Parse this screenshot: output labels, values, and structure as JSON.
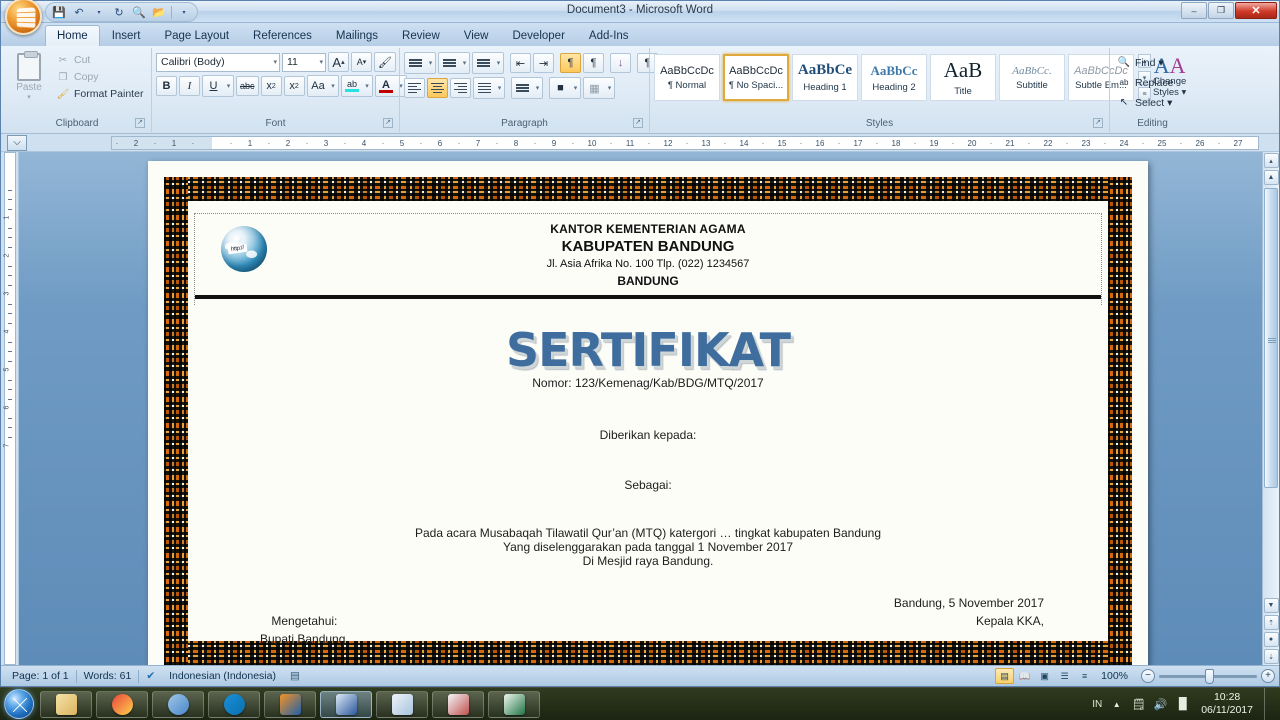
{
  "window": {
    "title": "Document3 - Microsoft Word",
    "min_label": "–",
    "restore_label": "❐",
    "close_label": "✕"
  },
  "quick_access": [
    {
      "name": "save-icon",
      "glyph": "💾"
    },
    {
      "name": "undo-icon",
      "glyph": "↶"
    },
    {
      "name": "undo-dropdown-icon",
      "glyph": "▾"
    },
    {
      "name": "redo-icon",
      "glyph": "↻"
    },
    {
      "name": "print-preview-icon",
      "glyph": "🔍"
    },
    {
      "name": "open-icon",
      "glyph": "📂"
    },
    {
      "name": "customize-qat-icon",
      "glyph": "▾"
    }
  ],
  "tabs": [
    {
      "label": "Home",
      "active": true
    },
    {
      "label": "Insert",
      "active": false
    },
    {
      "label": "Page Layout",
      "active": false
    },
    {
      "label": "References",
      "active": false
    },
    {
      "label": "Mailings",
      "active": false
    },
    {
      "label": "Review",
      "active": false
    },
    {
      "label": "View",
      "active": false
    },
    {
      "label": "Developer",
      "active": false
    },
    {
      "label": "Add-Ins",
      "active": false
    }
  ],
  "ribbon": {
    "clipboard": {
      "label": "Clipboard",
      "paste_label": "Paste",
      "paste_arrow": "▾",
      "commands": [
        {
          "label": "Cut",
          "icon": "scissors-icon",
          "glyph": "✂"
        },
        {
          "label": "Copy",
          "icon": "copy-icon",
          "glyph": "❐"
        },
        {
          "label": "Format Painter",
          "icon": "format-painter-icon",
          "glyph": "🖌"
        }
      ]
    },
    "font": {
      "label": "Font",
      "font_name": "Calibri (Body)",
      "font_size": "11",
      "grow_label": "A",
      "shrink_label": "A",
      "clear_formatting_label": "🖌",
      "bold_label": "B",
      "italic_label": "I",
      "underline_label": "U",
      "strike_label": "abc",
      "subscript_label": "x",
      "subscript_sub": "2",
      "superscript_label": "x",
      "superscript_sup": "2",
      "change_case_label": "Aa",
      "highlight_label": "ab",
      "font_color_label": "A"
    },
    "paragraph": {
      "label": "Paragraph",
      "bullets": "≡",
      "numbering": "≡",
      "multilevel": "≡",
      "decrease_indent": "⇤",
      "increase_indent": "⇥",
      "ltr": "¶",
      "rtl": "¶",
      "sort": "↓",
      "show_marks": "¶",
      "align_left": "≡",
      "align_center": "≡",
      "align_right": "≡",
      "justify": "≡",
      "line_spacing": "≡",
      "shading": "■",
      "borders": "▦"
    },
    "styles": {
      "label": "Styles",
      "gallery": [
        {
          "preview": "AaBbCcDc",
          "name": "¶ Normal",
          "selected": false
        },
        {
          "preview": "AaBbCcDc",
          "name": "¶ No Spaci...",
          "selected": true
        },
        {
          "preview": "AaBbCе",
          "name": "Heading 1",
          "selected": false
        },
        {
          "preview": "AaBbCc",
          "name": "Heading 2",
          "selected": false
        },
        {
          "preview": "AaB",
          "name": "Title",
          "selected": false
        },
        {
          "preview": "AaBbCc.",
          "name": "Subtitle",
          "selected": false
        },
        {
          "preview": "AaBbCcDc",
          "name": "Subtle Em...",
          "selected": false
        }
      ],
      "scroll_up": "▴",
      "scroll_down": "▾",
      "more": "≡",
      "change_styles_line1": "Change",
      "change_styles_line2": "Styles ▾"
    },
    "editing": {
      "label": "Editing",
      "commands": [
        {
          "label": "Find ▾",
          "icon": "binoculars-icon",
          "glyph": "🔍"
        },
        {
          "label": "Replace",
          "icon": "replace-icon",
          "glyph": "ab"
        },
        {
          "label": "Select ▾",
          "icon": "select-icon",
          "glyph": "↖"
        }
      ]
    }
  },
  "ruler": {
    "tab_stop_glyph": "⌵",
    "left_ticks": [
      "2",
      "1"
    ],
    "right_ticks": [
      "1",
      "2",
      "3",
      "4",
      "5",
      "6",
      "7",
      "8",
      "9",
      "10",
      "11",
      "12",
      "13",
      "14",
      "15",
      "16",
      "17",
      "18",
      "19",
      "20",
      "21",
      "22",
      "23",
      "24",
      "25",
      "26",
      "27"
    ],
    "vertical_ticks": [
      "1",
      "2",
      "3",
      "4",
      "5",
      "6",
      "7"
    ]
  },
  "document": {
    "letterhead": {
      "line1": "KANTOR KEMENTERIAN AGAMA",
      "line2": "KABUPATEN BANDUNG",
      "line3": "Jl. Asia Afrika No. 100 Tlp. (022) 1234567",
      "line4": "BANDUNG",
      "logo_name": "globe-internet-logo"
    },
    "title": "SERTIFIKAT",
    "title_color": "#3f6e9e",
    "nomor": "Nomor: 123/Kemenag/Kab/BDG/MTQ/2017",
    "given_to": "Diberikan kepada:",
    "as": "Sebagai:",
    "body": [
      "Pada acara Musabaqah Tilawatil Qur’an (MTQ) katergori … tingkat kabupaten Bandung",
      "Yang diselenggarakan pada tanggal 1 November 2017",
      "Di Mesjid raya Bandung."
    ],
    "sign_right_line1": "Bandung, 5 November 2017",
    "sign_right_line2": "Kepala KKA,",
    "sign_left_line1": "Mengetahui:",
    "sign_left_line2": "Bupati Bandung,"
  },
  "statusbar": {
    "page": "Page: 1 of 1",
    "words": "Words: 61",
    "proofing_icon": "spellcheck-icon",
    "proofing_glyph": "✔",
    "language": "Indonesian (Indonesia)",
    "macro_icon": "macro-record-icon",
    "macro_glyph": "▤",
    "zoom": "100%",
    "zoom_out": "−",
    "zoom_in": "+",
    "views": [
      {
        "name": "print-layout-view",
        "glyph": "▤",
        "active": true
      },
      {
        "name": "full-screen-reading-view",
        "glyph": "📖",
        "active": false
      },
      {
        "name": "web-layout-view",
        "glyph": "▣",
        "active": false
      },
      {
        "name": "outline-view",
        "glyph": "☰",
        "active": false
      },
      {
        "name": "draft-view",
        "glyph": "≡",
        "active": false
      }
    ]
  },
  "taskbar": {
    "start_name": "start-button",
    "items": [
      {
        "name": "taskbar-windows-explorer",
        "color1": "#f6e2a8",
        "color2": "#d9b45e",
        "active": false
      },
      {
        "name": "taskbar-google-chrome",
        "color1": "#e8453c",
        "color2": "#ffd04b",
        "active": false
      },
      {
        "name": "taskbar-chromium",
        "color1": "#9fc6e8",
        "color2": "#4a86c8",
        "active": false
      },
      {
        "name": "taskbar-teamviewer",
        "color1": "#1a8fd8",
        "color2": "#0a6fae",
        "active": false
      },
      {
        "name": "taskbar-mozilla-firefox",
        "color1": "#f59324",
        "color2": "#1f5fa8",
        "active": false
      },
      {
        "name": "taskbar-microsoft-word",
        "color1": "#dce9f6",
        "color2": "#2b579a",
        "active": true
      },
      {
        "name": "taskbar-notepad",
        "color1": "#eef3f8",
        "color2": "#a8c3dc",
        "active": false
      },
      {
        "name": "taskbar-microsoft-powerpoint",
        "color1": "#f3f6f9",
        "color2": "#c0504d",
        "active": false
      },
      {
        "name": "taskbar-microsoft-excel",
        "color1": "#eef7ee",
        "color2": "#217346",
        "active": false
      }
    ],
    "tray": {
      "language": "IN",
      "show_hidden": "▲",
      "action_center_glyph": "🗒",
      "volume_glyph": "🔊",
      "network_glyph": "█",
      "time": "10:28",
      "date": "06/11/2017"
    }
  }
}
